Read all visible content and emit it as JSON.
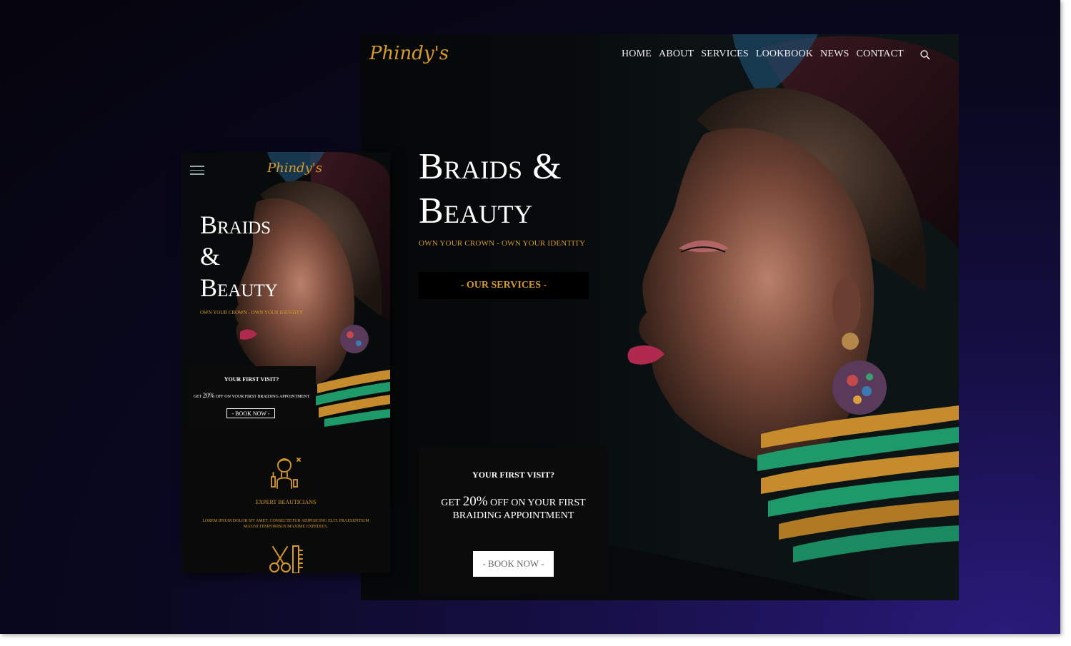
{
  "brand": {
    "logo_text": "Phindy's"
  },
  "desktop": {
    "nav": [
      "HOME",
      "ABOUT",
      "SERVICES",
      "LOOKBOOK",
      "NEWS",
      "CONTACT"
    ],
    "hero": {
      "title_line1": "Braids &",
      "title_line2": "Beauty",
      "subtitle": "OWN YOUR CROWN - OWN YOUR IDENTITY",
      "cta": "- OUR SERVICES -"
    },
    "offer": {
      "title": "YOUR FIRST VISIT?",
      "text_pre": "GET ",
      "text_percent": "20%",
      "text_post": " OFF ON YOUR FIRST BRAIDING APPOINTMENT",
      "button": "- BOOK NOW -"
    }
  },
  "mobile": {
    "hero": {
      "title_line1": "Braids",
      "title_line2": "&",
      "title_line3": "Beauty",
      "subtitle": "OWN YOUR CROWN - OWN YOUR IDENTITY"
    },
    "offer": {
      "title": "YOUR FIRST VISIT?",
      "text_pre": "GET ",
      "text_percent": "20%",
      "text_post": " OFF ON YOUR FIRST BRAIDING APPOINTMENT",
      "button": "- BOOK NOW -"
    },
    "feature": {
      "title": "EXPERT BEAUTICIANS",
      "text": "LOREM IPSUM DOLOR SIT AMET, CONSECTETUR ADIPISICING ELIT. PRAESENTIUM MAGNI TEMPORIBUS MAXIME EXPEDITA."
    }
  },
  "colors": {
    "accent": "#d79a2b",
    "dark": "#06090a",
    "white": "#ffffff"
  },
  "icons": [
    "search-icon",
    "menu-icon",
    "beautician-icon",
    "scissors-comb-icon"
  ]
}
